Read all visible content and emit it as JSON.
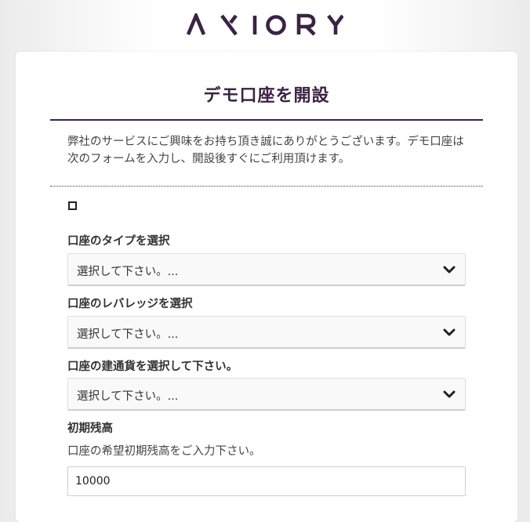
{
  "brand": {
    "logo_text": "AXIORY",
    "logo_color": "#3b2343"
  },
  "page": {
    "title": "デモ口座を開設",
    "intro": "弊社のサービスにご興味をお持ち頂き誠にありがとうございます。デモ口座は次のフォームを入力し、開設後すぐにご利用頂けます。"
  },
  "form": {
    "account_type": {
      "label": "口座のタイプを選択",
      "selected": "選択して下さい。...",
      "icon": "chevron-down-icon"
    },
    "leverage": {
      "label": "口座のレバレッジを選択",
      "selected": "選択して下さい。...",
      "icon": "chevron-down-icon"
    },
    "currency": {
      "label": "口座の建通貨を選択して下さい。",
      "selected": "選択して下さい。...",
      "icon": "chevron-down-icon"
    },
    "initial_balance": {
      "label": "初期残高",
      "help": "口座の希望初期残高をご入力下さい。",
      "value": "10000"
    }
  },
  "colors": {
    "accent": "#3b2343",
    "select_bg": "#f9f9f9"
  }
}
